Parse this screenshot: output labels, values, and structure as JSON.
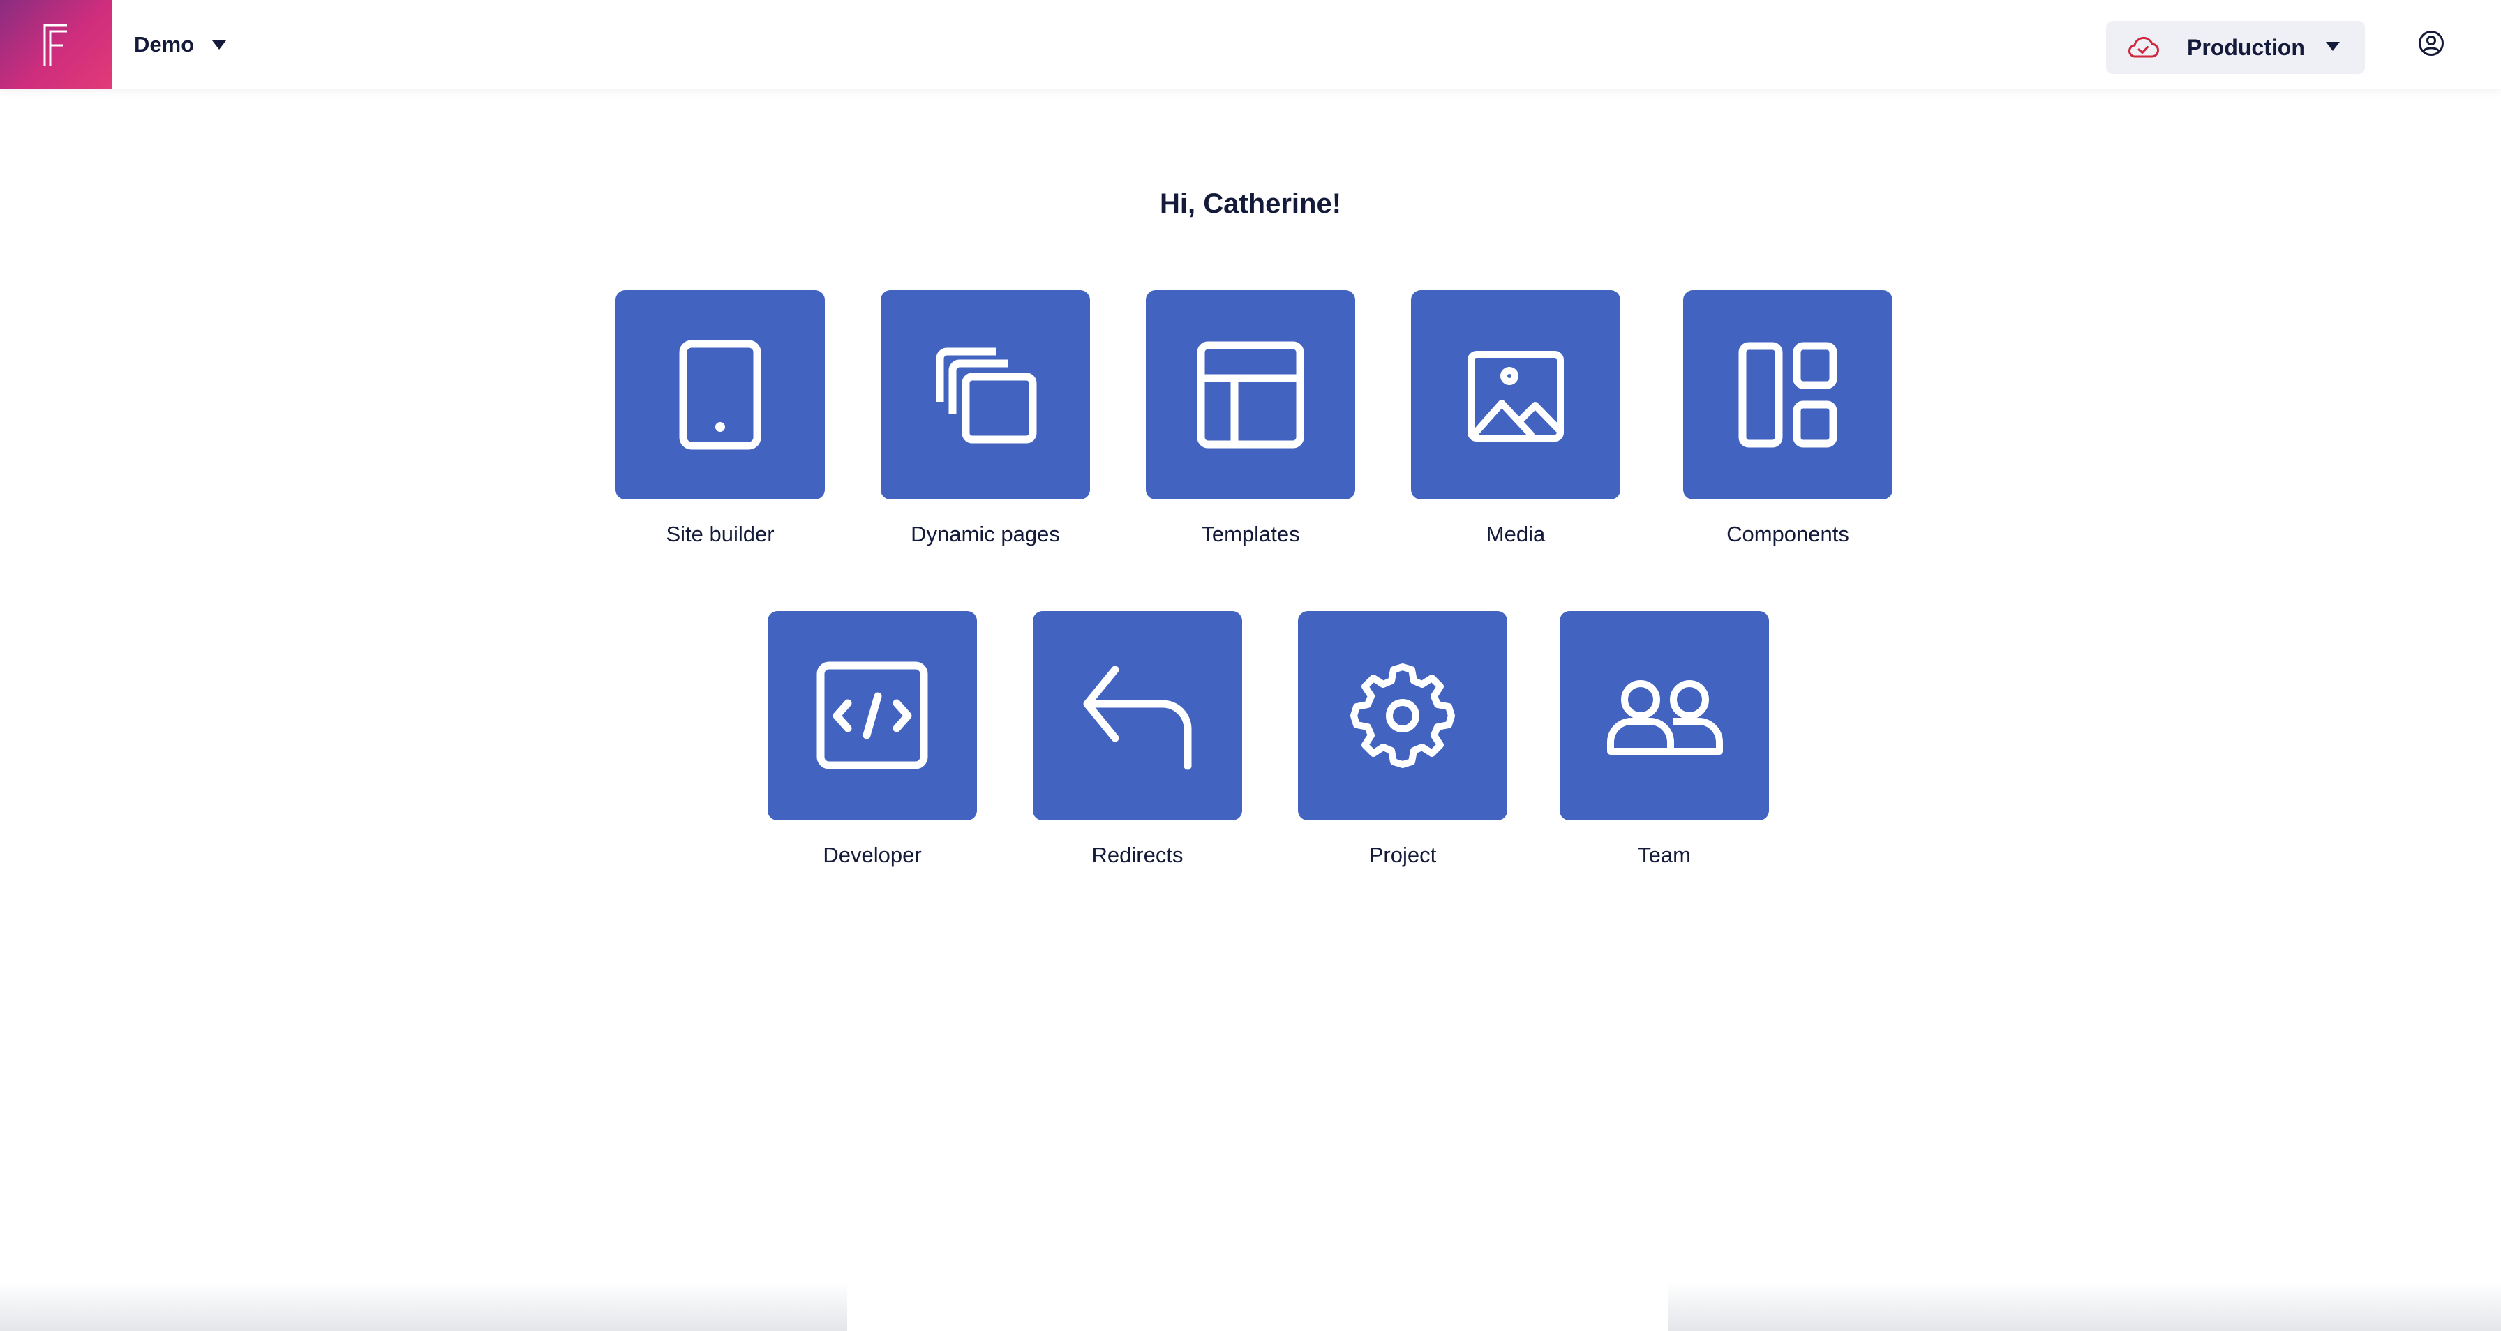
{
  "header": {
    "logo_icon": "f-logo-icon",
    "project_name": "Demo",
    "environment": {
      "name": "Production",
      "icon": "cloud-check-icon",
      "icon_color": "#d0273f"
    },
    "account_icon": "user-circle-icon"
  },
  "greeting": "Hi, Catherine!",
  "tiles": [
    {
      "label": "Site builder",
      "icon": "mobile-device-icon"
    },
    {
      "label": "Dynamic pages",
      "icon": "stacked-pages-icon"
    },
    {
      "label": "Templates",
      "icon": "layout-template-icon"
    },
    {
      "label": "Media",
      "icon": "image-icon"
    },
    {
      "label": "Components",
      "icon": "components-grid-icon"
    },
    {
      "label": "Developer",
      "icon": "code-icon"
    },
    {
      "label": "Redirects",
      "icon": "redirect-arrow-icon"
    },
    {
      "label": "Project",
      "icon": "gear-icon"
    },
    {
      "label": "Team",
      "icon": "users-icon"
    }
  ],
  "colors": {
    "tile_background": "#4263c0",
    "text": "#141b3a",
    "logo_gradient_start": "#8a2d80",
    "logo_gradient_end": "#e23b78"
  }
}
